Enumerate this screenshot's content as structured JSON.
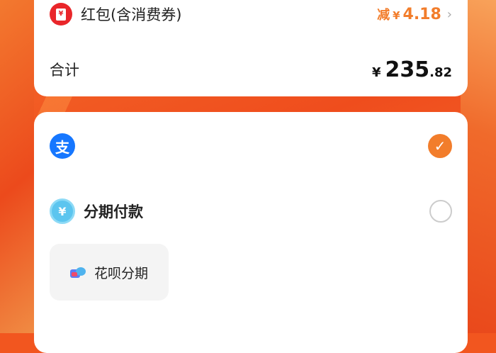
{
  "summary": {
    "hongbao": {
      "icon": "red-envelope-icon",
      "label": "红包(含消费券)",
      "discount_prefix": "减",
      "currency": "¥",
      "discount_amount": "4.18"
    },
    "total": {
      "label": "合计",
      "currency": "¥",
      "amount_integer": "235",
      "amount_decimal": ".82"
    }
  },
  "payment": {
    "options": [
      {
        "name": "alipay",
        "icon": "alipay-icon",
        "icon_glyph": "支",
        "selected": true
      },
      {
        "name": "installment",
        "icon": "installment-icon",
        "icon_glyph": "¥",
        "label": "分期付款",
        "selected": false
      }
    ],
    "installment_chip": {
      "icon": "huabei-icon",
      "label": "花呗分期"
    }
  },
  "colors": {
    "accent": "#f27d2b",
    "hongbao_red": "#e9262a",
    "alipay_blue": "#1677ff",
    "background_orange": "#f2561f"
  }
}
